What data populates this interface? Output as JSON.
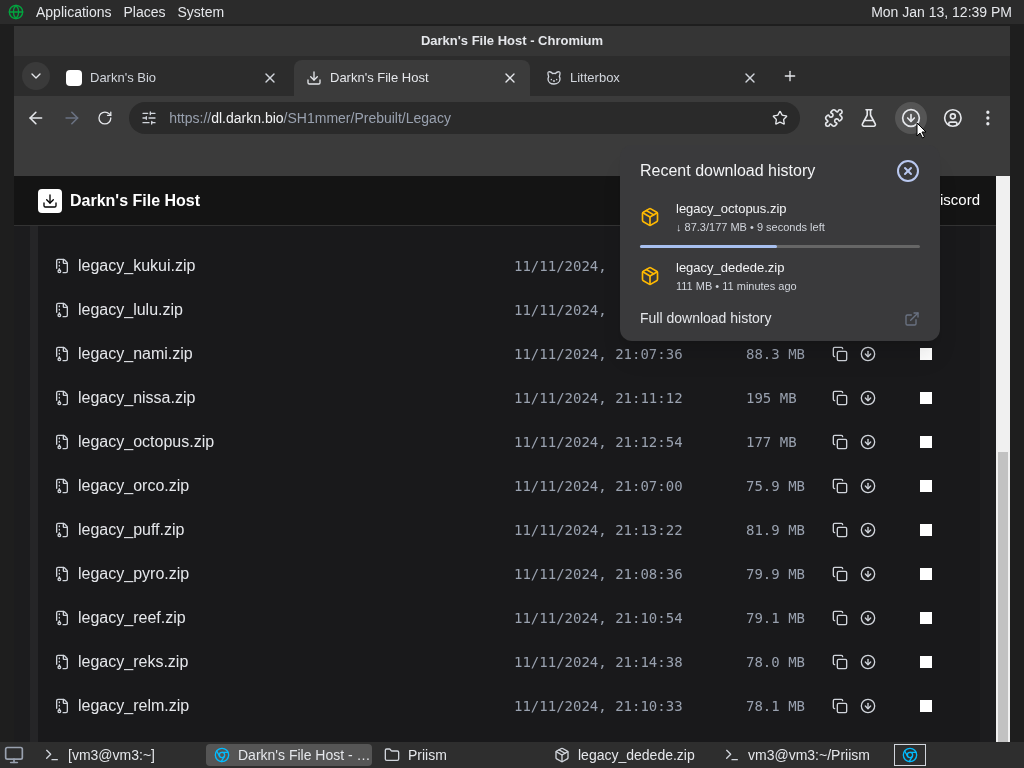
{
  "top_panel": {
    "menus": [
      "Applications",
      "Places",
      "System"
    ],
    "clock": "Mon Jan 13, 12:39 PM"
  },
  "window": {
    "title": "Darkn's File Host - Chromium"
  },
  "tabs": [
    {
      "title": "Darkn's Bio",
      "kind": "bio",
      "selected": false
    },
    {
      "title": "Darkn's File Host",
      "kind": "download",
      "selected": true
    },
    {
      "title": "Litterbox",
      "kind": "litterbox",
      "selected": false
    }
  ],
  "address_bar": {
    "scheme": "https://",
    "host": "dl.darkn.bio",
    "path": "/SH1mmer/Prebuilt/Legacy"
  },
  "site": {
    "title": "Darkn's File Host",
    "nav_link": "iscord"
  },
  "files": [
    {
      "name": "legacy_kukui.zip",
      "date": "11/11/2024,"
    },
    {
      "name": "legacy_lulu.zip",
      "date": "11/11/2024,"
    },
    {
      "name": "legacy_nami.zip",
      "date": "11/11/2024, 21:07:36",
      "size": "88.3 MB",
      "checked": false
    },
    {
      "name": "legacy_nissa.zip",
      "date": "11/11/2024, 21:11:12",
      "size": "195 MB",
      "checked": false
    },
    {
      "name": "legacy_octopus.zip",
      "date": "11/11/2024, 21:12:54",
      "size": "177 MB",
      "checked": false
    },
    {
      "name": "legacy_orco.zip",
      "date": "11/11/2024, 21:07:00",
      "size": "75.9 MB",
      "checked": false
    },
    {
      "name": "legacy_puff.zip",
      "date": "11/11/2024, 21:13:22",
      "size": "81.9 MB",
      "checked": false
    },
    {
      "name": "legacy_pyro.zip",
      "date": "11/11/2024, 21:08:36",
      "size": "79.9 MB",
      "checked": false
    },
    {
      "name": "legacy_reef.zip",
      "date": "11/11/2024, 21:10:54",
      "size": "79.1 MB",
      "checked": false
    },
    {
      "name": "legacy_reks.zip",
      "date": "11/11/2024, 21:14:38",
      "size": "78.0 MB",
      "checked": false
    },
    {
      "name": "legacy_relm.zip",
      "date": "11/11/2024, 21:10:33",
      "size": "78.1 MB",
      "checked": false
    }
  ],
  "downloads_popup": {
    "title": "Recent download history",
    "items": [
      {
        "name": "legacy_octopus.zip",
        "status": "↓ 87.3/177 MB • 9 seconds left",
        "level": 0.49
      },
      {
        "name": "legacy_dedede.zip",
        "status": "111 MB • 11 minutes ago"
      }
    ],
    "footer_link": "Full download history"
  },
  "taskbar": [
    {
      "label": "[vm3@vm3:~]",
      "kind": "terminal",
      "selected": false
    },
    {
      "label": "Darkn's File Host - …",
      "kind": "browser",
      "selected": true
    },
    {
      "label": "Priism",
      "kind": "folder",
      "selected": false
    },
    {
      "label": "legacy_dedede.zip",
      "kind": "archive",
      "selected": false
    },
    {
      "label": "vm3@vm3:~/Priism",
      "kind": "terminal",
      "selected": false
    }
  ]
}
